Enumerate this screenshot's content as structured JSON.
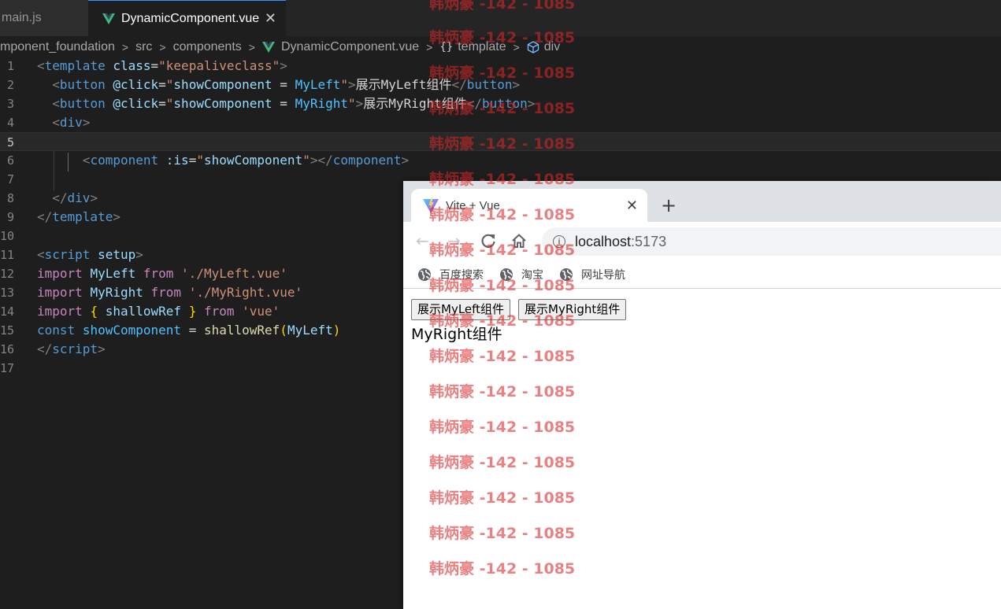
{
  "editor": {
    "tabs": [
      {
        "label": "main.js",
        "active": false
      },
      {
        "label": "DynamicComponent.vue",
        "active": true
      }
    ],
    "breadcrumb": [
      "mponent_foundation",
      "src",
      "components",
      "DynamicComponent.vue",
      "template",
      "div"
    ],
    "current_line": 5,
    "line_numbers": [
      "1",
      "2",
      "3",
      "4",
      "5",
      "6",
      "7",
      "8",
      "9",
      "10",
      "11",
      "12",
      "13",
      "14",
      "15",
      "16",
      "17"
    ]
  },
  "browser": {
    "tab_title": "Vite + Vue",
    "url_host": "localhost",
    "url_port": ":5173",
    "bookmarks": [
      "百度搜索",
      "淘宝",
      "网址导航"
    ],
    "page": {
      "buttons": [
        "展示MyLeft组件",
        "展示MyRight组件"
      ],
      "text": "MyRight组件"
    }
  },
  "watermark": {
    "text": "韩炳豪 -142 - 1085",
    "repeat": 17
  },
  "colors": {
    "editor_bg": "#1e1e1e",
    "tab_active_border": "#3794ff",
    "vue_green": "#41b883",
    "watermark": "#d72828"
  }
}
